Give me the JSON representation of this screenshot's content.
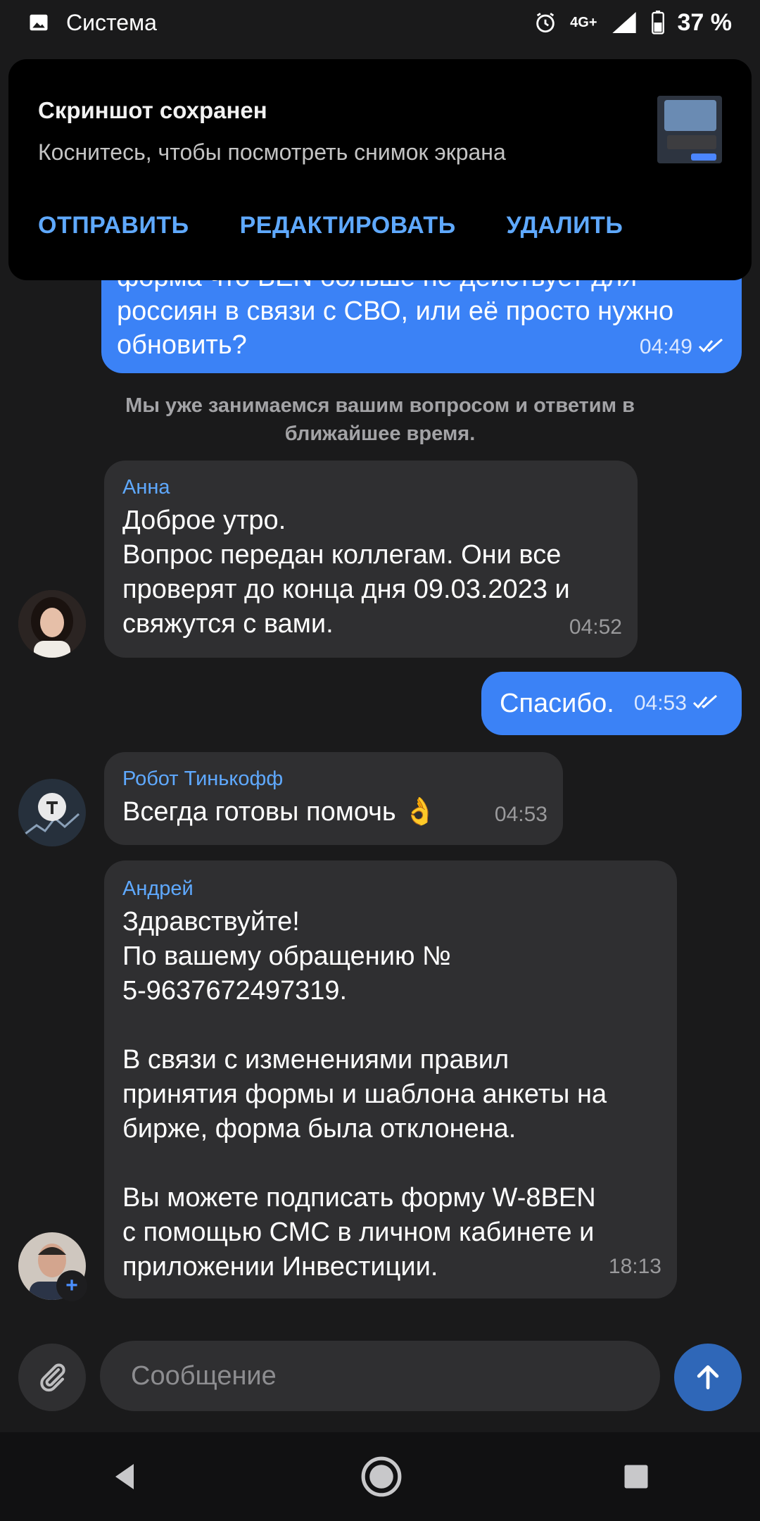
{
  "status_bar": {
    "app_name": "Система",
    "network": "4G+",
    "battery": "37 %"
  },
  "toast": {
    "title": "Скриншот сохранен",
    "subtitle": "Коснитесь, чтобы посмотреть снимок экрана",
    "actions": [
      "ОТПРАВИТЬ",
      "РЕДАКТИРОВАТЬ",
      "УДАЛИТЬ"
    ]
  },
  "messages": [
    {
      "direction": "out",
      "text": "форма что BEN больше не действует для\nроссиян в связи с СВО, или её просто нужно\nобновить?",
      "time": "04:49"
    },
    {
      "direction": "system",
      "text": "Мы уже занимаемся вашим вопросом и ответим в ближайшее время."
    },
    {
      "direction": "in",
      "sender": "Анна",
      "text": "Доброе утро.\nВопрос передан коллегам. Они все\nпроверят до конца дня 09.03.2023 и\nсвяжутся с вами.",
      "time": "04:52"
    },
    {
      "direction": "out",
      "text": "Спасибо.",
      "time": "04:53"
    },
    {
      "direction": "in",
      "sender": "Робот Тинькофф",
      "text": "Всегда готовы помочь 👌",
      "time": "04:53"
    },
    {
      "direction": "in",
      "sender": "Андрей",
      "text": "Здравствуйте!\nПо вашему обращению №\n5-9637672497319.\n\nВ связи с изменениями правил\nпринятия формы и шаблона анкеты на\nбирже, форма была отклонена.\n\nВы можете подписать форму W-8BEN\nс помощью СМС в личном кабинете и\nприложении Инвестиции.",
      "time": "18:13"
    }
  ],
  "composer": {
    "placeholder": "Сообщение"
  },
  "icons": [
    "image-icon",
    "alarm-icon",
    "signal-icon",
    "battery-icon",
    "double-check-icon",
    "paperclip-icon",
    "arrow-up-icon",
    "back-icon",
    "home-icon",
    "recents-icon"
  ],
  "colors": {
    "background": "#1a1a1b",
    "outgoing_bubble": "#3b82f6",
    "incoming_bubble": "#2f2f31",
    "accent": "#5fa9ff",
    "send_button": "#2f67b8"
  }
}
